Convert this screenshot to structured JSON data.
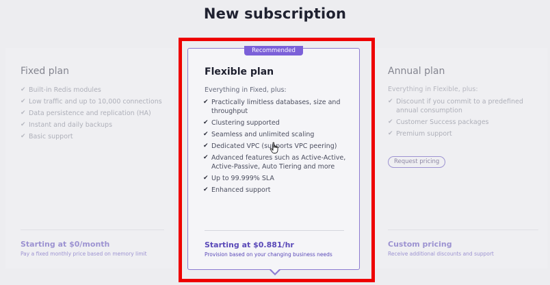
{
  "page": {
    "title": "New subscription"
  },
  "plans": {
    "fixed": {
      "name": "Fixed plan",
      "features": [
        "Built-in Redis modules",
        "Low traffic and up to 10,000 connections",
        "Data persistence and replication (HA)",
        "Instant and daily backups",
        "Basic support"
      ],
      "price": "Starting at $0/month",
      "price_desc": "Pay a fixed monthly price based on memory limit"
    },
    "flexible": {
      "badge": "Recommended",
      "name": "Flexible plan",
      "intro": "Everything in Fixed, plus:",
      "features": [
        "Practically limitless databases, size and throughput",
        "Clustering supported",
        "Seamless and unlimited scaling",
        "Dedicated VPC (supports VPC peering)",
        "Advanced features such as Active-Active, Active-Passive, Auto Tiering and more",
        "Up to 99.999% SLA",
        "Enhanced support"
      ],
      "price": "Starting at $0.881/hr",
      "price_desc": "Provision based on your changing business needs"
    },
    "annual": {
      "name": "Annual plan",
      "intro": "Everything in Flexible, plus:",
      "features": [
        "Discount if you commit to a predefined annual consumption",
        "Customer Success packages",
        "Premium support"
      ],
      "button": "Request pricing",
      "price": "Custom pricing",
      "price_desc": "Receive additional discounts and support"
    }
  },
  "icons": {
    "check": "checkmark-icon",
    "cursor": "hand-pointer-icon"
  },
  "colors": {
    "accent": "#5a49b8",
    "badge": "#7b60d8",
    "highlight": "#ee0000"
  }
}
